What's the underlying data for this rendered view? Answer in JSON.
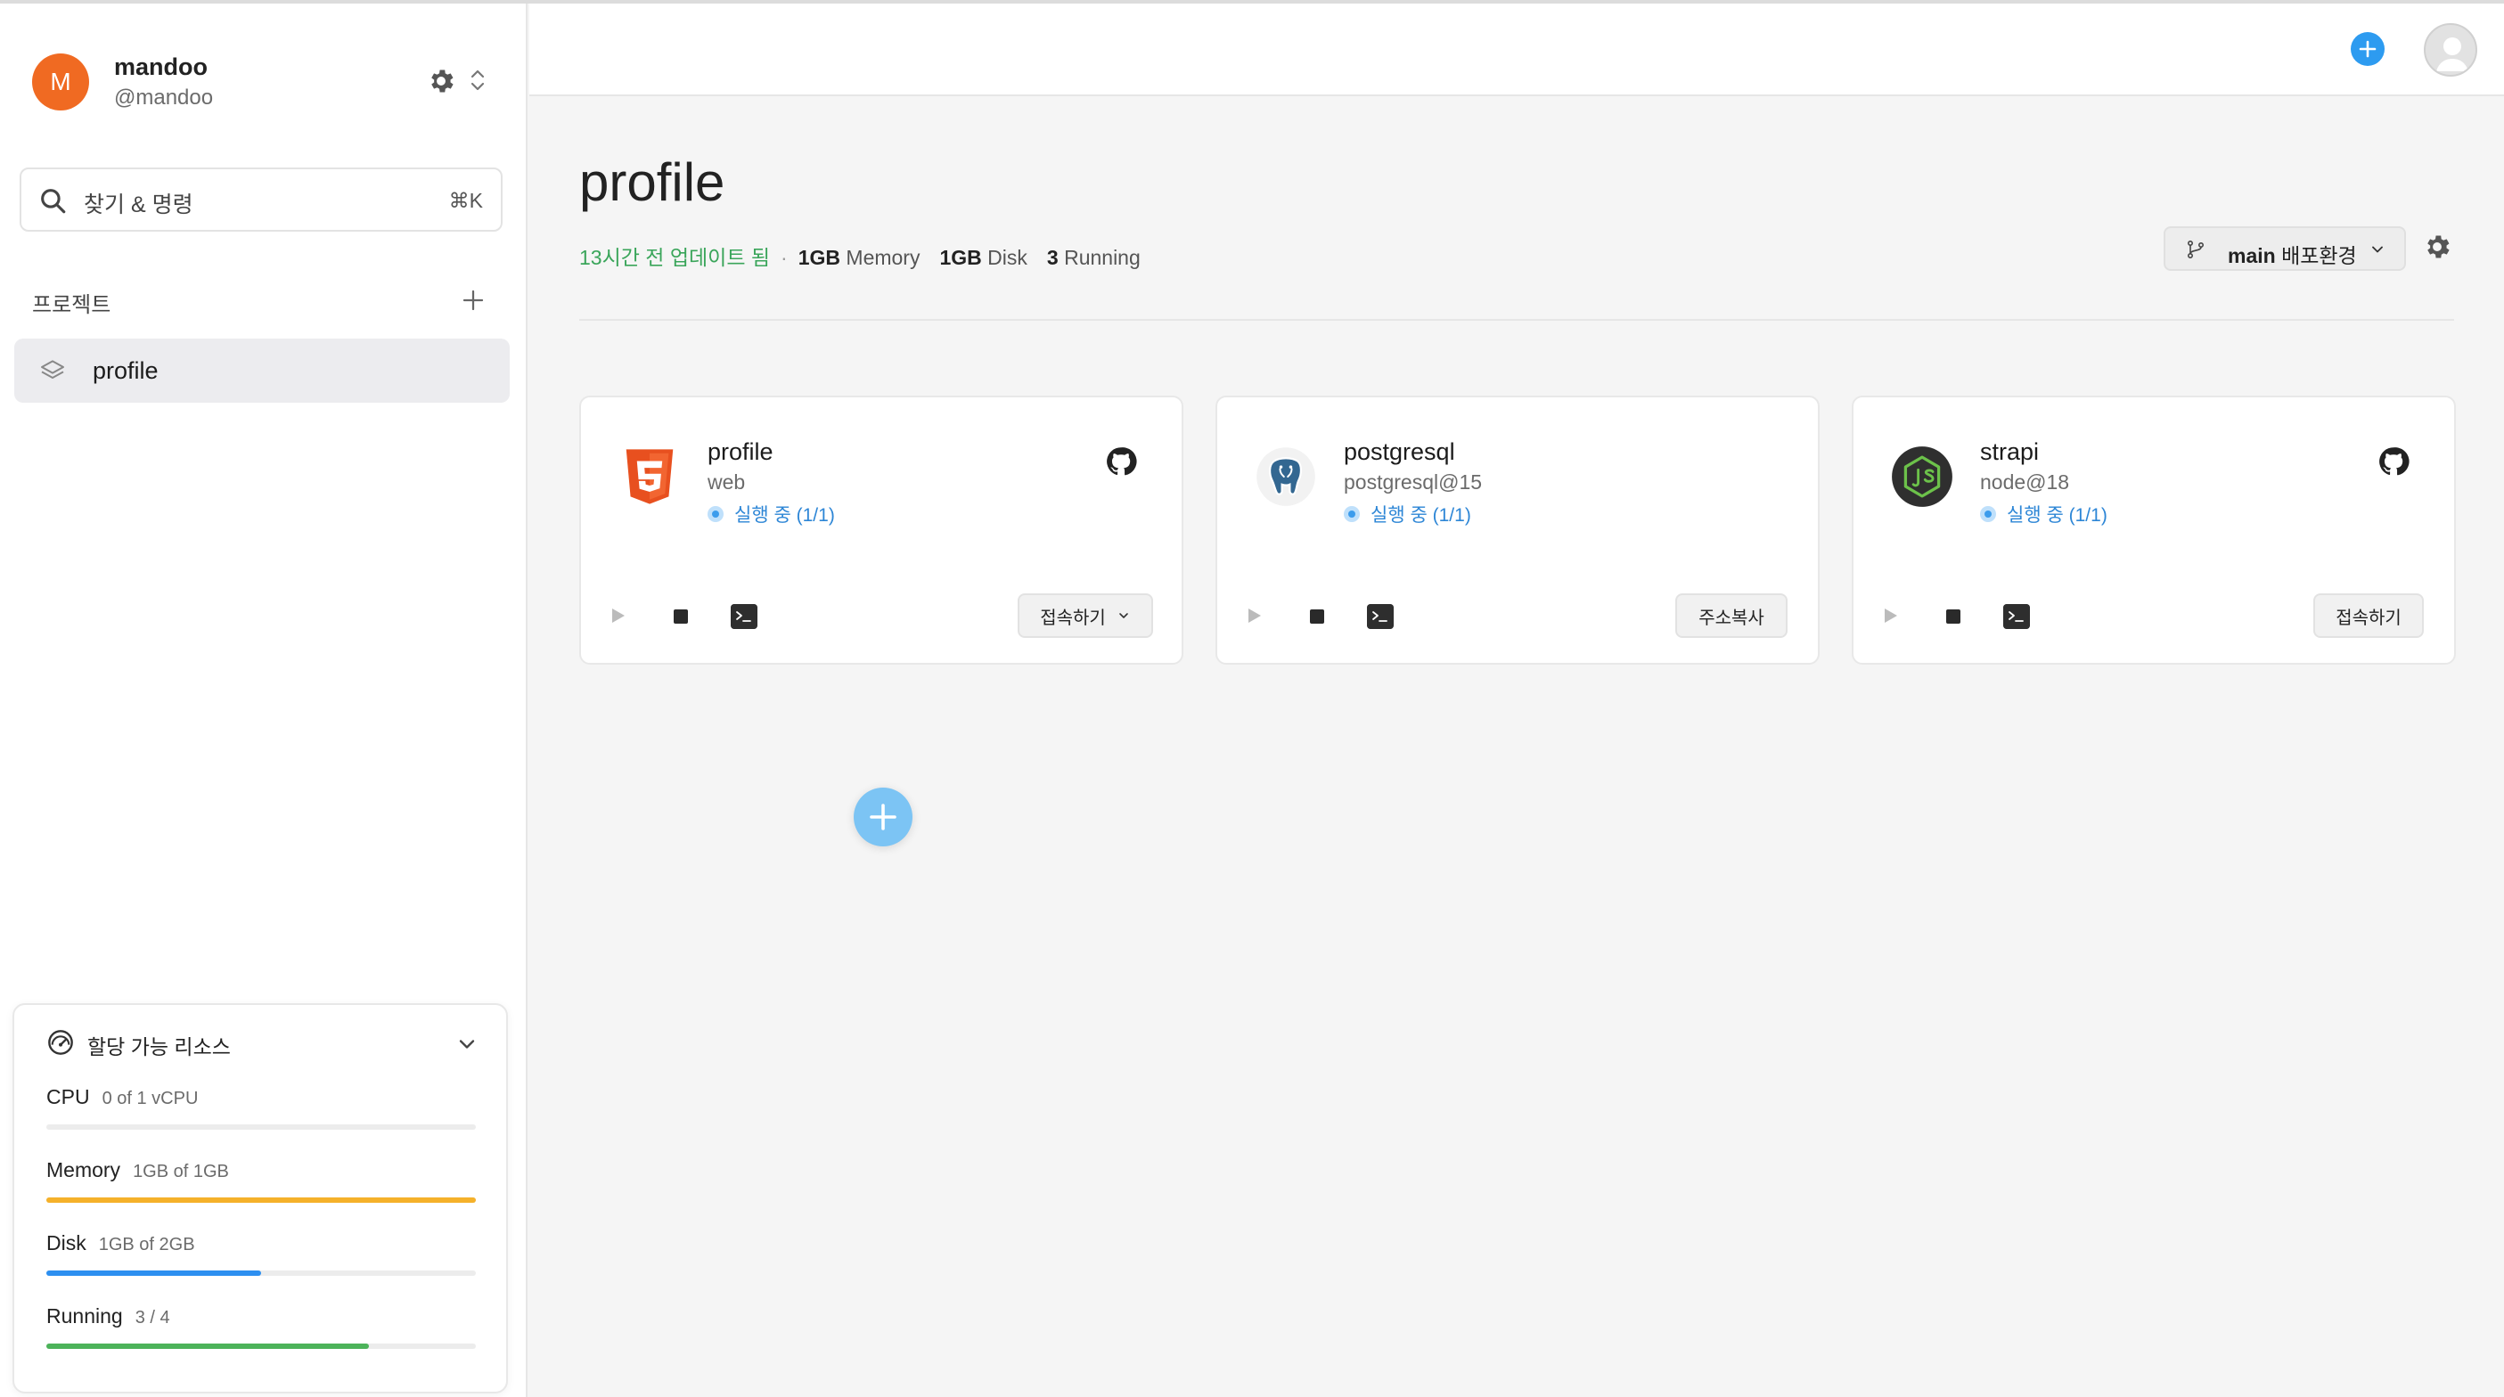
{
  "sidebar": {
    "user": {
      "avatar_letter": "M",
      "name": "mandoo",
      "handle": "@mandoo"
    },
    "search": {
      "placeholder": "찾기 & 명령",
      "shortcut": "⌘K"
    },
    "projects_header": "프로젝트",
    "projects": [
      {
        "label": "profile",
        "icon": "layers-icon",
        "selected": true
      }
    ],
    "resources": {
      "title": "할당 가능 리소스",
      "items": [
        {
          "name": "CPU",
          "value": "0 of 1 vCPU",
          "fraction": 0.0,
          "color": "#cfcfcf"
        },
        {
          "name": "Memory",
          "value": "1GB of 1GB",
          "fraction": 1.0,
          "color": "#f5b12a"
        },
        {
          "name": "Disk",
          "value": "1GB of 2GB",
          "fraction": 0.5,
          "color": "#2d8ff0"
        },
        {
          "name": "Running",
          "value": "3 / 4",
          "fraction": 0.75,
          "color": "#4cb35a"
        }
      ]
    }
  },
  "header": {
    "add_icon": "plus-circle-icon",
    "avatar_icon": "user-avatar-icon"
  },
  "main": {
    "title": "profile",
    "meta": {
      "updated": "13시간 전 업데이트 됨",
      "separator": "·",
      "memory_value": "1GB",
      "memory_label": "Memory",
      "disk_value": "1GB",
      "disk_label": "Disk",
      "running_value": "3",
      "running_label": "Running"
    },
    "branch": {
      "name": "main",
      "env": "배포환경"
    },
    "cards": [
      {
        "title": "profile",
        "subtitle": "web",
        "status": "실행 중 (1/1)",
        "logo": "html5-icon",
        "github": true,
        "button": "접속하기",
        "button_has_dropdown": true
      },
      {
        "title": "postgresql",
        "subtitle": "postgresql@15",
        "status": "실행 중 (1/1)",
        "logo": "postgresql-icon",
        "github": false,
        "button": "주소복사",
        "button_has_dropdown": false
      },
      {
        "title": "strapi",
        "subtitle": "node@18",
        "status": "실행 중 (1/1)",
        "logo": "nodejs-icon",
        "github": true,
        "button": "접속하기",
        "button_has_dropdown": false
      }
    ]
  },
  "colors": {
    "accent": "#2d9bf0",
    "updated_text": "#3aa55a",
    "status_text": "#2d86d6",
    "avatar": "#f06a22"
  }
}
